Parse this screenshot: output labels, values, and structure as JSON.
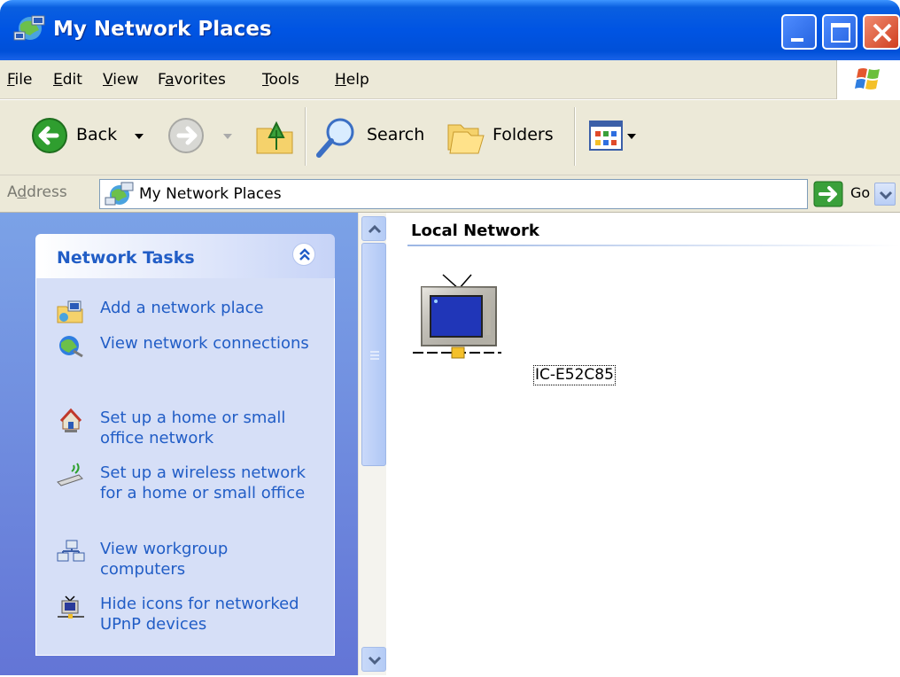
{
  "window": {
    "title": "My Network Places"
  },
  "menu": {
    "file": {
      "label": "File",
      "accel": "F",
      "rest": "ile"
    },
    "edit": {
      "label": "Edit",
      "accel": "E",
      "rest": "dit"
    },
    "view": {
      "label": "View",
      "accel": "V",
      "rest": "iew"
    },
    "favorites": {
      "label": "Favorites",
      "pre": "F",
      "accel": "a",
      "rest": "vorites"
    },
    "tools": {
      "label": "Tools",
      "accel": "T",
      "rest": "ools"
    },
    "help": {
      "label": "Help",
      "accel": "H",
      "rest": "elp"
    }
  },
  "toolbar": {
    "back_label": "Back",
    "search_label": "Search",
    "folders_label": "Folders"
  },
  "address": {
    "label_pre": "A",
    "label_accel": "d",
    "label_rest": "dress",
    "value": "My Network Places",
    "go_label": "Go"
  },
  "task_pane": {
    "title": "Network Tasks",
    "items": [
      {
        "label": "Add a network place",
        "icon": "add-network-place-icon"
      },
      {
        "label": "View network connections",
        "icon": "network-connections-icon"
      },
      {
        "label": "Set up a home or small office network",
        "icon": "home-network-icon"
      },
      {
        "label": "Set up a wireless network for a home or small office",
        "icon": "wireless-network-icon"
      },
      {
        "label": "View workgroup computers",
        "icon": "workgroup-icon"
      },
      {
        "label": "Hide icons for networked UPnP devices",
        "icon": "upnp-device-icon"
      }
    ]
  },
  "content": {
    "group_title": "Local Network",
    "devices": [
      {
        "label": "IC-E52C85",
        "icon": "upnp-tv-device-icon"
      }
    ]
  },
  "colors": {
    "titlebar": "#0054e3",
    "task_pane_bg": "#7ba2e7",
    "task_link": "#215dc6",
    "chrome": "#ece9d8"
  }
}
